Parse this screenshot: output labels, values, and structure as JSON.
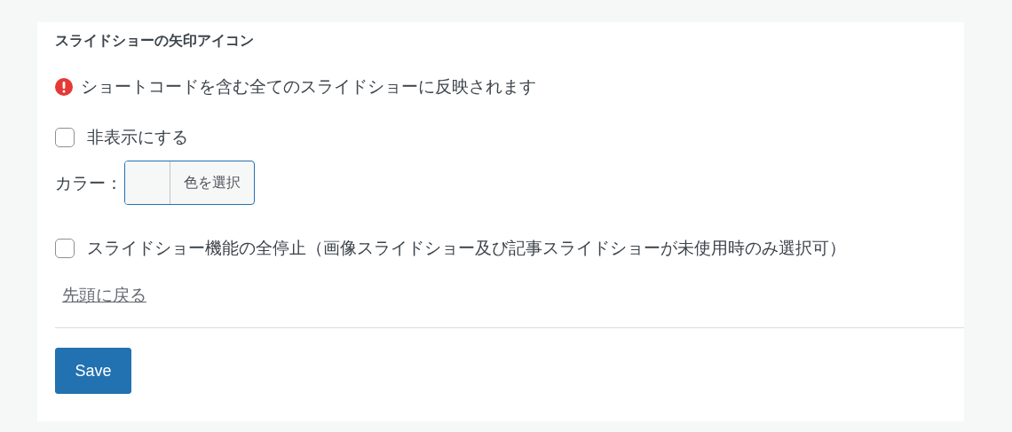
{
  "section_title": "スライドショーの矢印アイコン",
  "notice": {
    "kind": "error",
    "text": "ショートコードを含む全てのスライドショーに反映されます"
  },
  "hide_option": {
    "label": "非表示にする",
    "checked": false
  },
  "color_field": {
    "label": "カラー：",
    "button": "色を選択"
  },
  "disable_option": {
    "label": "スライドショー機能の全停止（画像スライドショー及び記事スライドショーが未使用時のみ選択可）",
    "checked": false
  },
  "back_link": "先頭に戻る",
  "save_button": "Save"
}
